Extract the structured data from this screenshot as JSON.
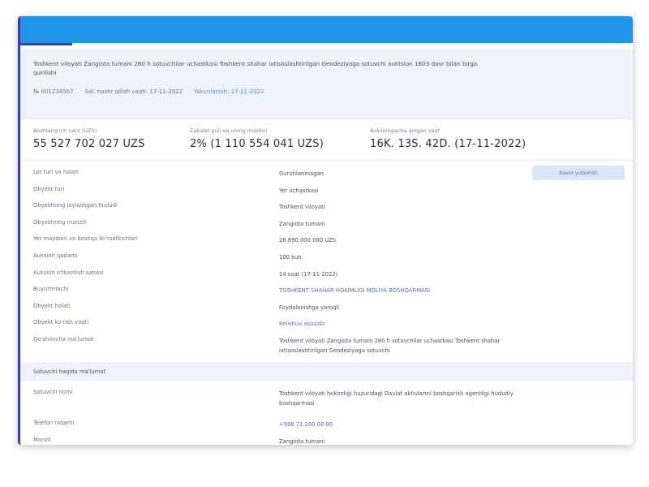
{
  "colors": {
    "header": "#1e97ea",
    "accent": "#3b3fa8",
    "panel": "#eef2fb",
    "link": "#4a6fcf"
  },
  "lot": {
    "title": "Toshkent viloyati Zangiota tumani 280 h sotuvchilar uchastkasi Toshkent shahar ixtisoslashtirilgan Geodeziyaga sotuvchi auktsion 1803 davr bilan birga qurilishi",
    "id": "№ 001234567",
    "published": "Sal. nashr qilish vaqti: 17-11-2022",
    "deadline": "Yakunlanish: 17-11-2022"
  },
  "stats": [
    {
      "label": "Boshlang'ich narx (UZS)",
      "value": "55 527 702 027 UZS"
    },
    {
      "label": "Zakalat puli va uning miqdori",
      "value": "2% (1 110 554 041 UZS)"
    },
    {
      "label": "Auksiongacha qolgan vaqt",
      "value": "16K.  13S.  42D.  (17-11-2022)"
    }
  ],
  "ask_button": "Savol yuborish",
  "details": [
    {
      "k": "Lot turi va holati",
      "v": "Guruhlanmagan"
    },
    {
      "k": "Obyekt turi",
      "v": "Yer uchastkasi"
    },
    {
      "k": "Obyektning joylashgan hududi",
      "v": "Toshkent viloyati"
    },
    {
      "k": "Obyektning manzili",
      "v": "Zangiota tumani"
    },
    {
      "k": "Yer maydoni va boshqa ko'rsatkichlari",
      "v": "26 890 000 000 UZS"
    },
    {
      "k": "Auksion qadami",
      "v": "100 kun"
    },
    {
      "k": "Auksion o'tkazilish sanasi",
      "v": "14 soat (17-11-2022)"
    },
    {
      "k": "Buyurtmachi",
      "v": "TOSHKENT SHAHAR HOKIMLIGI MOLIYA BOSHQARMASI",
      "link": true
    },
    {
      "k": "Obyekt holati",
      "v": "Foydalanishga yaroqli"
    },
    {
      "k": "Obyekt ko'rish vaqti",
      "v": "Kelishuv asosida",
      "link": true
    },
    {
      "k": "Qo'shimcha ma'lumot",
      "v": "Toshkent viloyati Zangiota tumani 280 h sotuvchilar uchastkasi Toshkent shahar ixtisoslashtirilgan Geodeziyaga sotuvchi",
      "tall": true
    }
  ],
  "section2": {
    "title": "Sotuvchi haqida ma'lumot",
    "rows": [
      {
        "k": "Sotuvchi nomi",
        "v": "Toshkent viloyati hokimligi huzuridagi Davlat aktivlarini boshqarish agentligi hududiy boshqarmasi",
        "tall": true
      },
      {
        "k": "Telefon raqami",
        "v": "+998 71 200 00 00",
        "link": true
      },
      {
        "k": "Manzil",
        "v": "Zangiota tumani"
      }
    ]
  }
}
